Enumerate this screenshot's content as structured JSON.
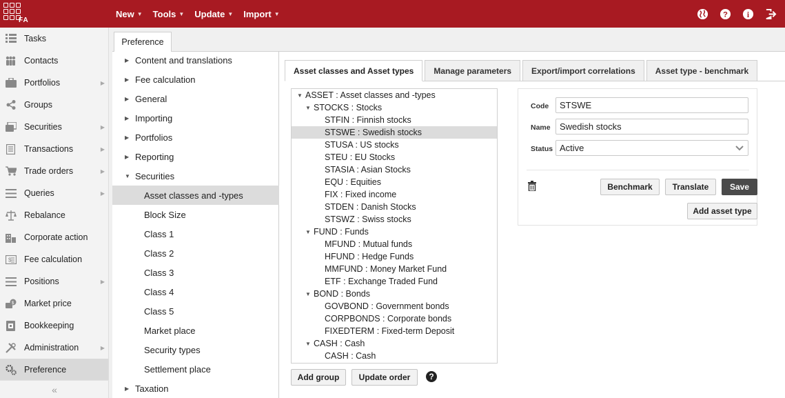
{
  "app": {
    "logo_text": "FA"
  },
  "menu": {
    "items": [
      {
        "label": "New"
      },
      {
        "label": "Tools"
      },
      {
        "label": "Update"
      },
      {
        "label": "Import"
      }
    ]
  },
  "sidebar": {
    "items": [
      {
        "label": "Tasks",
        "icon": "list-icon",
        "arrow": false
      },
      {
        "label": "Contacts",
        "icon": "people-icon",
        "arrow": false
      },
      {
        "label": "Portfolios",
        "icon": "briefcase-icon",
        "arrow": true
      },
      {
        "label": "Groups",
        "icon": "share-icon",
        "arrow": false
      },
      {
        "label": "Securities",
        "icon": "securities-icon",
        "arrow": true
      },
      {
        "label": "Transactions",
        "icon": "document-icon",
        "arrow": true
      },
      {
        "label": "Trade orders",
        "icon": "cart-icon",
        "arrow": true
      },
      {
        "label": "Queries",
        "icon": "query-list-icon",
        "arrow": true
      },
      {
        "label": "Rebalance",
        "icon": "scale-icon",
        "arrow": false
      },
      {
        "label": "Corporate action",
        "icon": "building-icon",
        "arrow": false
      },
      {
        "label": "Fee calculation",
        "icon": "fee-icon",
        "arrow": false
      },
      {
        "label": "Positions",
        "icon": "positions-icon",
        "arrow": true
      },
      {
        "label": "Market price",
        "icon": "market-icon",
        "arrow": false
      },
      {
        "label": "Bookkeeping",
        "icon": "book-icon",
        "arrow": false
      },
      {
        "label": "Administration",
        "icon": "tools-icon",
        "arrow": true
      },
      {
        "label": "Preference",
        "icon": "gears-icon",
        "arrow": false,
        "active": true
      }
    ],
    "collapse_label": "«"
  },
  "preference_tab": {
    "label": "Preference"
  },
  "left_tree": {
    "items": [
      {
        "label": "Content and translations",
        "expandable": true,
        "expanded": false
      },
      {
        "label": "Fee calculation",
        "expandable": true,
        "expanded": false
      },
      {
        "label": "General",
        "expandable": true,
        "expanded": false
      },
      {
        "label": "Importing",
        "expandable": true,
        "expanded": false
      },
      {
        "label": "Portfolios",
        "expandable": true,
        "expanded": false
      },
      {
        "label": "Reporting",
        "expandable": true,
        "expanded": false
      },
      {
        "label": "Securities",
        "expandable": true,
        "expanded": true
      },
      {
        "label": "Asset classes and -types",
        "child": true,
        "selected": true
      },
      {
        "label": "Block Size",
        "child": true
      },
      {
        "label": "Class 1",
        "child": true
      },
      {
        "label": "Class 2",
        "child": true
      },
      {
        "label": "Class 3",
        "child": true
      },
      {
        "label": "Class 4",
        "child": true
      },
      {
        "label": "Class 5",
        "child": true
      },
      {
        "label": "Market place",
        "child": true
      },
      {
        "label": "Security types",
        "child": true
      },
      {
        "label": "Settlement place",
        "child": true
      },
      {
        "label": "Taxation",
        "expandable": true,
        "expanded": false
      }
    ]
  },
  "tabs": [
    {
      "label": "Asset classes and Asset types",
      "active": true
    },
    {
      "label": "Manage parameters"
    },
    {
      "label": "Export/import correlations"
    },
    {
      "label": "Asset type - benchmark"
    }
  ],
  "asset_tree": {
    "nodes": [
      {
        "label": "ASSET : Asset classes and -types",
        "level": 0,
        "expanded": true
      },
      {
        "label": "STOCKS : Stocks",
        "level": 1,
        "expanded": true
      },
      {
        "label": "STFIN : Finnish stocks",
        "level": 2
      },
      {
        "label": "STSWE : Swedish stocks",
        "level": 2,
        "selected": true
      },
      {
        "label": "STUSA : US stocks",
        "level": 2
      },
      {
        "label": "STEU : EU Stocks",
        "level": 2
      },
      {
        "label": "STASIA : Asian Stocks",
        "level": 2
      },
      {
        "label": "EQU : Equities",
        "level": 2
      },
      {
        "label": "FIX : Fixed income",
        "level": 2
      },
      {
        "label": "STDEN : Danish Stocks",
        "level": 2
      },
      {
        "label": "STSWZ : Swiss stocks",
        "level": 2
      },
      {
        "label": "FUND : Funds",
        "level": 1,
        "expanded": true
      },
      {
        "label": "MFUND : Mutual funds",
        "level": 2
      },
      {
        "label": "HFUND : Hedge Funds",
        "level": 2
      },
      {
        "label": "MMFUND : Money Market Fund",
        "level": 2
      },
      {
        "label": "ETF : Exchange Traded Fund",
        "level": 2
      },
      {
        "label": "BOND : Bonds",
        "level": 1,
        "expanded": true
      },
      {
        "label": "GOVBOND : Government bonds",
        "level": 2
      },
      {
        "label": "CORPBONDS : Corporate bonds",
        "level": 2
      },
      {
        "label": "FIXEDTERM : Fixed-term Deposit",
        "level": 2
      },
      {
        "label": "CASH : Cash",
        "level": 1,
        "expanded": true
      },
      {
        "label": "CASH : Cash",
        "level": 2
      }
    ]
  },
  "tree_buttons": {
    "add_group": "Add group",
    "update_order": "Update order"
  },
  "form": {
    "code_label": "Code",
    "code_value": "STSWE",
    "name_label": "Name",
    "name_value": "Swedish stocks",
    "status_label": "Status",
    "status_value": "Active",
    "benchmark_button": "Benchmark",
    "translate_button": "Translate",
    "save_button": "Save",
    "add_asset_type_button": "Add asset type"
  },
  "colors": {
    "brand": "#a81a22",
    "selected_row": "#dcdcdc",
    "save_button": "#4a4a4a"
  }
}
